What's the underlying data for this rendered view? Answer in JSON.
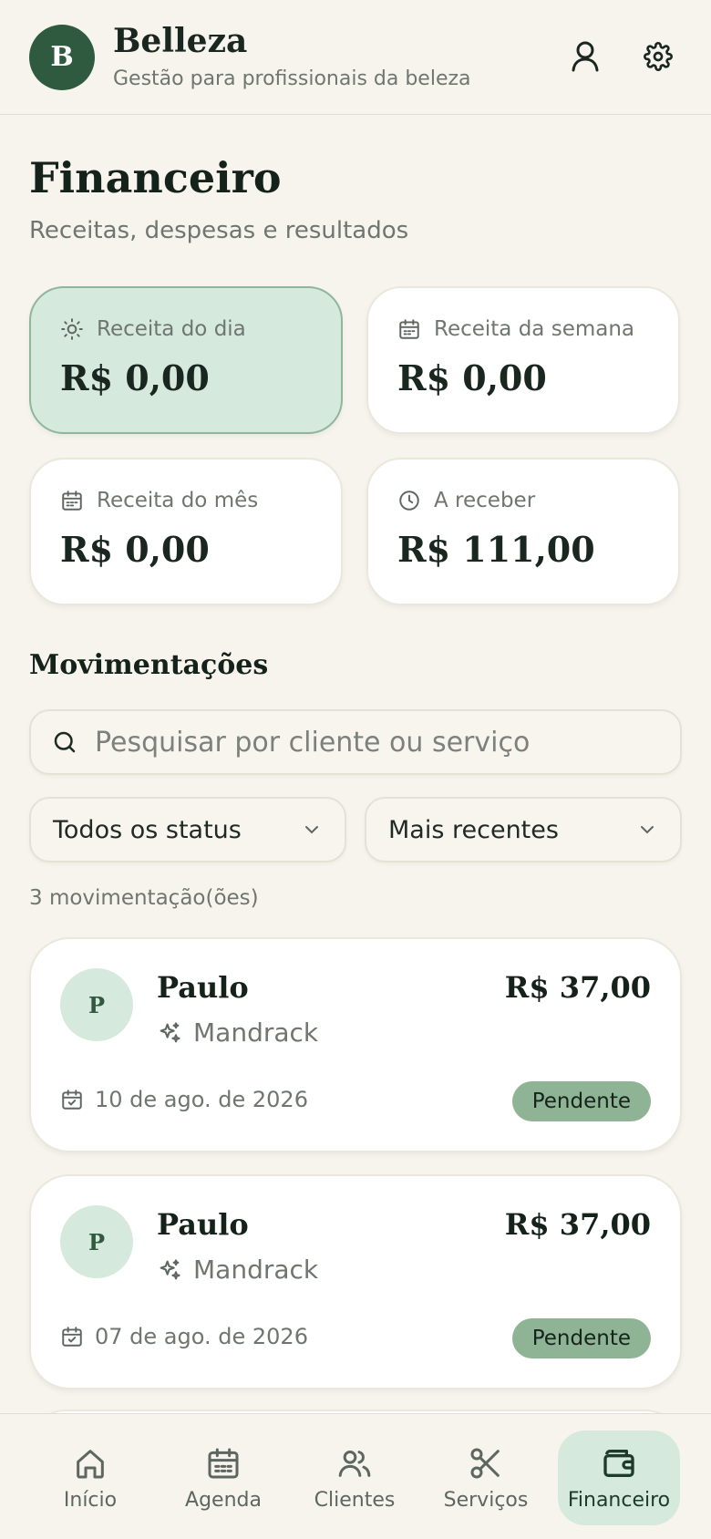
{
  "app": {
    "logo_letter": "B",
    "name": "Belleza",
    "subtitle": "Gestão para profissionais da beleza"
  },
  "header_icons": [
    "user-icon",
    "gear-icon"
  ],
  "page": {
    "title": "Financeiro",
    "subtitle": "Receitas, despesas e resultados"
  },
  "stats": [
    {
      "label": "Receita do dia",
      "value": "R$ 0,00",
      "icon": "sun-icon",
      "active": true
    },
    {
      "label": "Receita da semana",
      "value": "R$ 0,00",
      "icon": "calendar-icon",
      "active": false
    },
    {
      "label": "Receita do mês",
      "value": "R$ 0,00",
      "icon": "calendar-icon",
      "active": false
    },
    {
      "label": "A receber",
      "value": "R$ 111,00",
      "icon": "clock-icon",
      "active": false
    }
  ],
  "movements": {
    "title": "Movimentações",
    "search_placeholder": "Pesquisar por cliente ou serviço",
    "status_filter": "Todos os status",
    "sort": "Mais recentes",
    "count_text": "3 movimentação(ões)",
    "items": [
      {
        "initial": "P",
        "name": "Paulo",
        "service": "Mandrack",
        "amount": "R$ 37,00",
        "date": "10 de ago. de 2026",
        "status": "Pendente"
      },
      {
        "initial": "P",
        "name": "Paulo",
        "service": "Mandrack",
        "amount": "R$ 37,00",
        "date": "07 de ago. de 2026",
        "status": "Pendente"
      }
    ]
  },
  "nav": [
    {
      "label": "Início",
      "icon": "home-icon",
      "active": false
    },
    {
      "label": "Agenda",
      "icon": "calendar-icon",
      "active": false
    },
    {
      "label": "Clientes",
      "icon": "users-icon",
      "active": false
    },
    {
      "label": "Serviços",
      "icon": "scissors-icon",
      "active": false
    },
    {
      "label": "Financeiro",
      "icon": "wallet-icon",
      "active": true
    }
  ],
  "colors": {
    "accent": "#2f5a40",
    "accent_light": "#d6e9dd",
    "badge": "#8eb395",
    "background": "#f7f4ee"
  }
}
